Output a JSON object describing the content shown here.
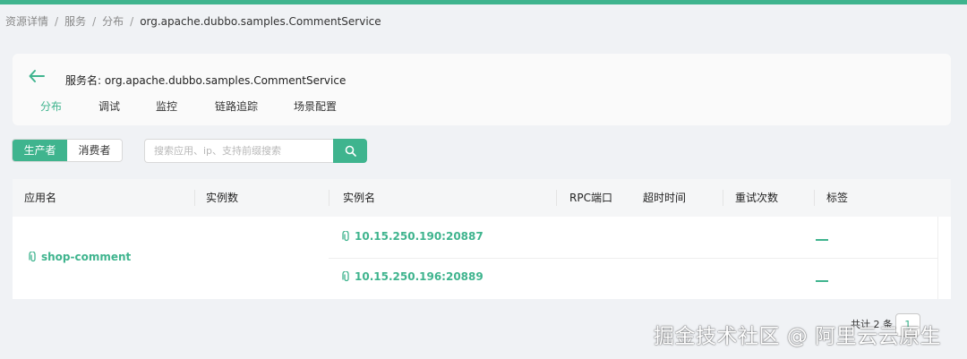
{
  "colors": {
    "accent": "#3fb48e",
    "background": "#f0f2f5"
  },
  "breadcrumb": {
    "items": [
      "资源详情",
      "服务",
      "分布"
    ],
    "current": "org.apache.dubbo.samples.CommentService"
  },
  "header": {
    "back_icon": "arrow-left-icon",
    "service_label": "服务名:",
    "service_name": "org.apache.dubbo.samples.CommentService"
  },
  "tabs": [
    {
      "label": "分布",
      "active": true
    },
    {
      "label": "调试",
      "active": false
    },
    {
      "label": "监控",
      "active": false
    },
    {
      "label": "链路追踪",
      "active": false
    },
    {
      "label": "场景配置",
      "active": false
    }
  ],
  "toggle": {
    "provider_label": "生产者",
    "consumer_label": "消费者",
    "selected": "生产者"
  },
  "search": {
    "placeholder": "搜索应用、ip、支持前缀搜索",
    "value": "",
    "icon": "search-icon"
  },
  "table": {
    "columns": [
      "应用名",
      "实例数",
      "实例名",
      "RPC端口",
      "超时时间",
      "重试次数",
      "标签"
    ],
    "rows": [
      {
        "app": "shop-comment",
        "instances": [
          {
            "name": "10.15.250.190:20887",
            "tag": "—"
          },
          {
            "name": "10.15.250.196:20889",
            "tag": "—"
          }
        ]
      }
    ]
  },
  "pagination": {
    "total_text": "共计 2 条",
    "page": "1"
  },
  "watermark": "掘金技术社区 @ 阿里云云原生"
}
